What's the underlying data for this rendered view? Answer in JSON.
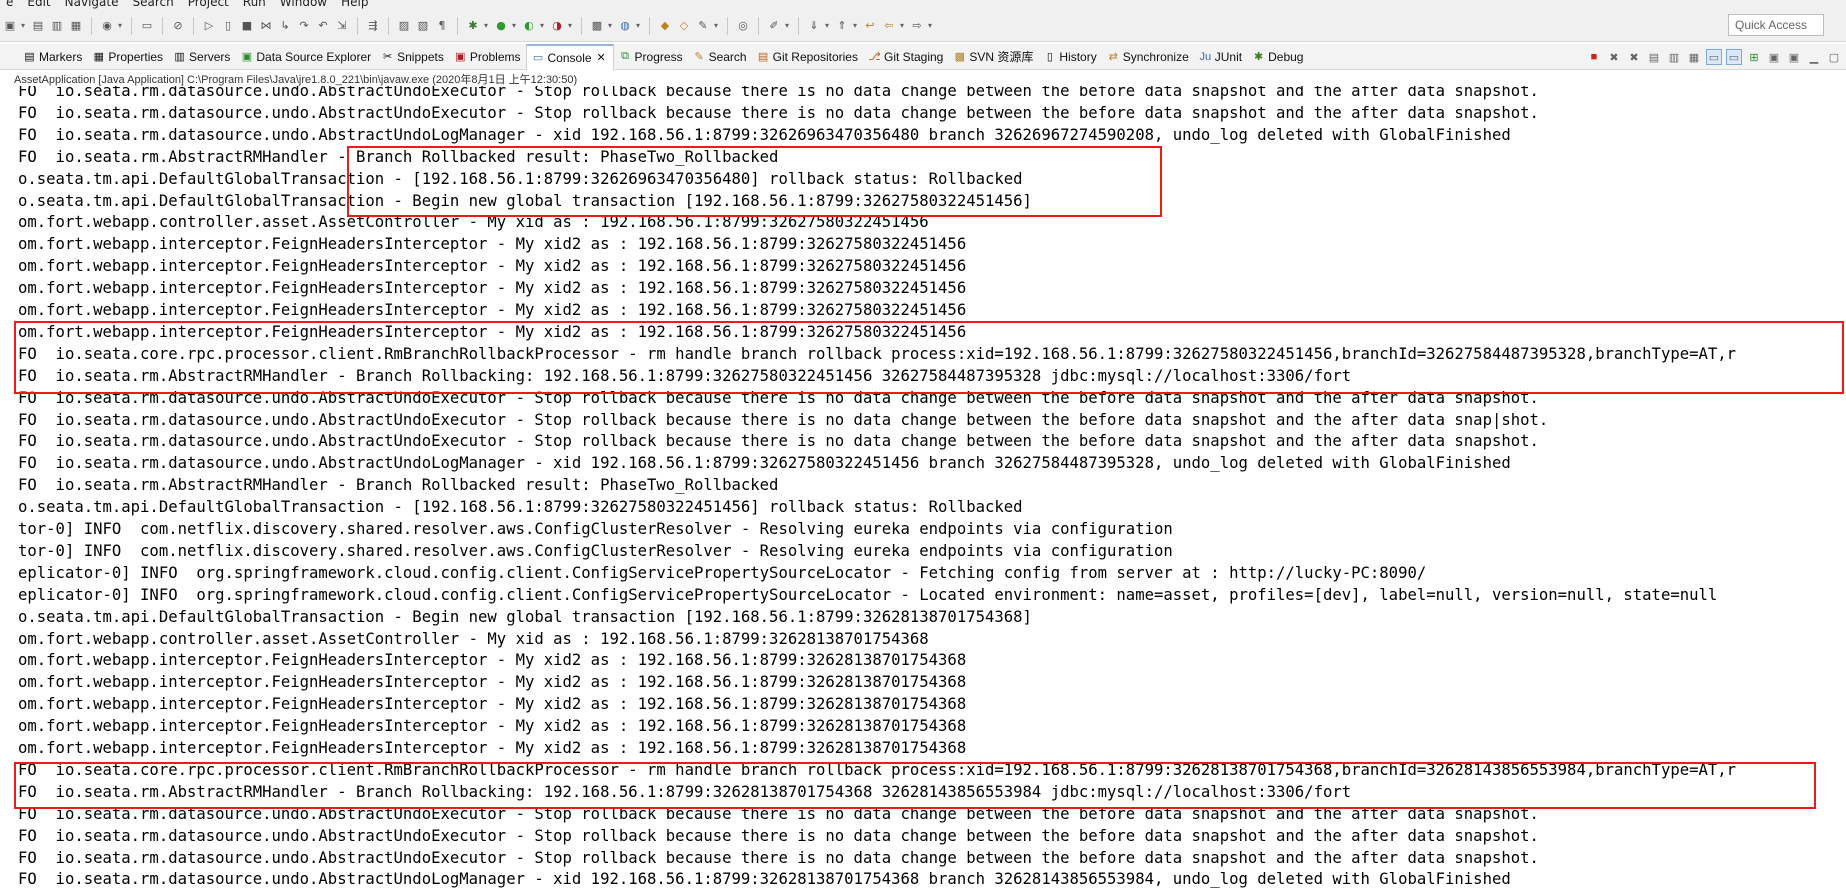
{
  "menu": [
    "e",
    "Edit",
    "Navigate",
    "Search",
    "Project",
    "Run",
    "Window",
    "Help"
  ],
  "toolbar": {
    "quick_access": "Quick Access"
  },
  "view_tabs": [
    {
      "label": "Markers",
      "icon": "markers-icon"
    },
    {
      "label": "Properties",
      "icon": "properties-icon"
    },
    {
      "label": "Servers",
      "icon": "servers-icon"
    },
    {
      "label": "Data Source Explorer",
      "icon": "datasource-icon"
    },
    {
      "label": "Snippets",
      "icon": "snippets-icon"
    },
    {
      "label": "Problems",
      "icon": "problems-icon"
    },
    {
      "label": "Console",
      "icon": "console-icon",
      "active": true
    },
    {
      "label": "Progress",
      "icon": "progress-icon"
    },
    {
      "label": "Search",
      "icon": "search-icon"
    },
    {
      "label": "Git Repositories",
      "icon": "git-repo-icon"
    },
    {
      "label": "Git Staging",
      "icon": "git-staging-icon"
    },
    {
      "label": "SVN 资源库",
      "icon": "svn-icon"
    },
    {
      "label": "History",
      "icon": "history-icon"
    },
    {
      "label": "Synchronize",
      "icon": "synchronize-icon"
    },
    {
      "label": "JUnit",
      "icon": "junit-icon"
    },
    {
      "label": "Debug",
      "icon": "debug-icon"
    }
  ],
  "console": {
    "title": "AssetApplication [Java Application] C:\\Program Files\\Java\\jre1.8.0_221\\bin\\javaw.exe (2020年8月1日 上午12:30:50)",
    "lines": [
      "FO  io.seata.rm.datasource.undo.AbstractUndoExecutor - Stop rollback because there is no data change between the before data snapshot and the after data snapshot.",
      "FO  io.seata.rm.datasource.undo.AbstractUndoExecutor - Stop rollback because there is no data change between the before data snapshot and the after data snapshot.",
      "FO  io.seata.rm.datasource.undo.AbstractUndoLogManager - xid 192.168.56.1:8799:32626963470356480 branch 32626967274590208, undo_log deleted with GlobalFinished",
      "FO  io.seata.rm.AbstractRMHandler - Branch Rollbacked result: PhaseTwo_Rollbacked",
      "o.seata.tm.api.DefaultGlobalTransaction - [192.168.56.1:8799:32626963470356480] rollback status: Rollbacked",
      "o.seata.tm.api.DefaultGlobalTransaction - Begin new global transaction [192.168.56.1:8799:32627580322451456]",
      "om.fort.webapp.controller.asset.AssetController - My xid as : 192.168.56.1:8799:32627580322451456",
      "om.fort.webapp.interceptor.FeignHeadersInterceptor - My xid2 as : 192.168.56.1:8799:32627580322451456",
      "om.fort.webapp.interceptor.FeignHeadersInterceptor - My xid2 as : 192.168.56.1:8799:32627580322451456",
      "om.fort.webapp.interceptor.FeignHeadersInterceptor - My xid2 as : 192.168.56.1:8799:32627580322451456",
      "om.fort.webapp.interceptor.FeignHeadersInterceptor - My xid2 as : 192.168.56.1:8799:32627580322451456",
      "om.fort.webapp.interceptor.FeignHeadersInterceptor - My xid2 as : 192.168.56.1:8799:32627580322451456",
      "FO  io.seata.core.rpc.processor.client.RmBranchRollbackProcessor - rm handle branch rollback process:xid=192.168.56.1:8799:32627580322451456,branchId=32627584487395328,branchType=AT,r",
      "FO  io.seata.rm.AbstractRMHandler - Branch Rollbacking: 192.168.56.1:8799:32627580322451456 32627584487395328 jdbc:mysql://localhost:3306/fort",
      "FO  io.seata.rm.datasource.undo.AbstractUndoExecutor - Stop rollback because there is no data change between the before data snapshot and the after data snapshot.",
      "FO  io.seata.rm.datasource.undo.AbstractUndoExecutor - Stop rollback because there is no data change between the before data snapshot and the after data snap|shot.",
      "FO  io.seata.rm.datasource.undo.AbstractUndoExecutor - Stop rollback because there is no data change between the before data snapshot and the after data snapshot.",
      "FO  io.seata.rm.datasource.undo.AbstractUndoLogManager - xid 192.168.56.1:8799:32627580322451456 branch 32627584487395328, undo_log deleted with GlobalFinished",
      "FO  io.seata.rm.AbstractRMHandler - Branch Rollbacked result: PhaseTwo_Rollbacked",
      "o.seata.tm.api.DefaultGlobalTransaction - [192.168.56.1:8799:32627580322451456] rollback status: Rollbacked",
      "tor-0] INFO  com.netflix.discovery.shared.resolver.aws.ConfigClusterResolver - Resolving eureka endpoints via configuration",
      "tor-0] INFO  com.netflix.discovery.shared.resolver.aws.ConfigClusterResolver - Resolving eureka endpoints via configuration",
      "eplicator-0] INFO  org.springframework.cloud.config.client.ConfigServicePropertySourceLocator - Fetching config from server at : http://lucky-PC:8090/",
      "eplicator-0] INFO  org.springframework.cloud.config.client.ConfigServicePropertySourceLocator - Located environment: name=asset, profiles=[dev], label=null, version=null, state=null",
      "o.seata.tm.api.DefaultGlobalTransaction - Begin new global transaction [192.168.56.1:8799:32628138701754368]",
      "om.fort.webapp.controller.asset.AssetController - My xid as : 192.168.56.1:8799:32628138701754368",
      "om.fort.webapp.interceptor.FeignHeadersInterceptor - My xid2 as : 192.168.56.1:8799:32628138701754368",
      "om.fort.webapp.interceptor.FeignHeadersInterceptor - My xid2 as : 192.168.56.1:8799:32628138701754368",
      "om.fort.webapp.interceptor.FeignHeadersInterceptor - My xid2 as : 192.168.56.1:8799:32628138701754368",
      "om.fort.webapp.interceptor.FeignHeadersInterceptor - My xid2 as : 192.168.56.1:8799:32628138701754368",
      "om.fort.webapp.interceptor.FeignHeadersInterceptor - My xid2 as : 192.168.56.1:8799:32628138701754368",
      "FO  io.seata.core.rpc.processor.client.RmBranchRollbackProcessor - rm handle branch rollback process:xid=192.168.56.1:8799:32628138701754368,branchId=32628143856553984,branchType=AT,r",
      "FO  io.seata.rm.AbstractRMHandler - Branch Rollbacking: 192.168.56.1:8799:32628138701754368 32628143856553984 jdbc:mysql://localhost:3306/fort",
      "FO  io.seata.rm.datasource.undo.AbstractUndoExecutor - Stop rollback because there is no data change between the before data snapshot and the after data snapshot.",
      "FO  io.seata.rm.datasource.undo.AbstractUndoExecutor - Stop rollback because there is no data change between the before data snapshot and the after data snapshot.",
      "FO  io.seata.rm.datasource.undo.AbstractUndoExecutor - Stop rollback because there is no data change between the before data snapshot and the after data snapshot.",
      "FO  io.seata.rm.datasource.undo.AbstractUndoLogManager - xid 192.168.56.1:8799:32628138701754368 branch 32628143856553984, undo_log deleted with GlobalFinished"
    ]
  },
  "colors": {
    "highlight_box": "#ee1b1b",
    "toolbar_bg": "#f0f0f0"
  }
}
